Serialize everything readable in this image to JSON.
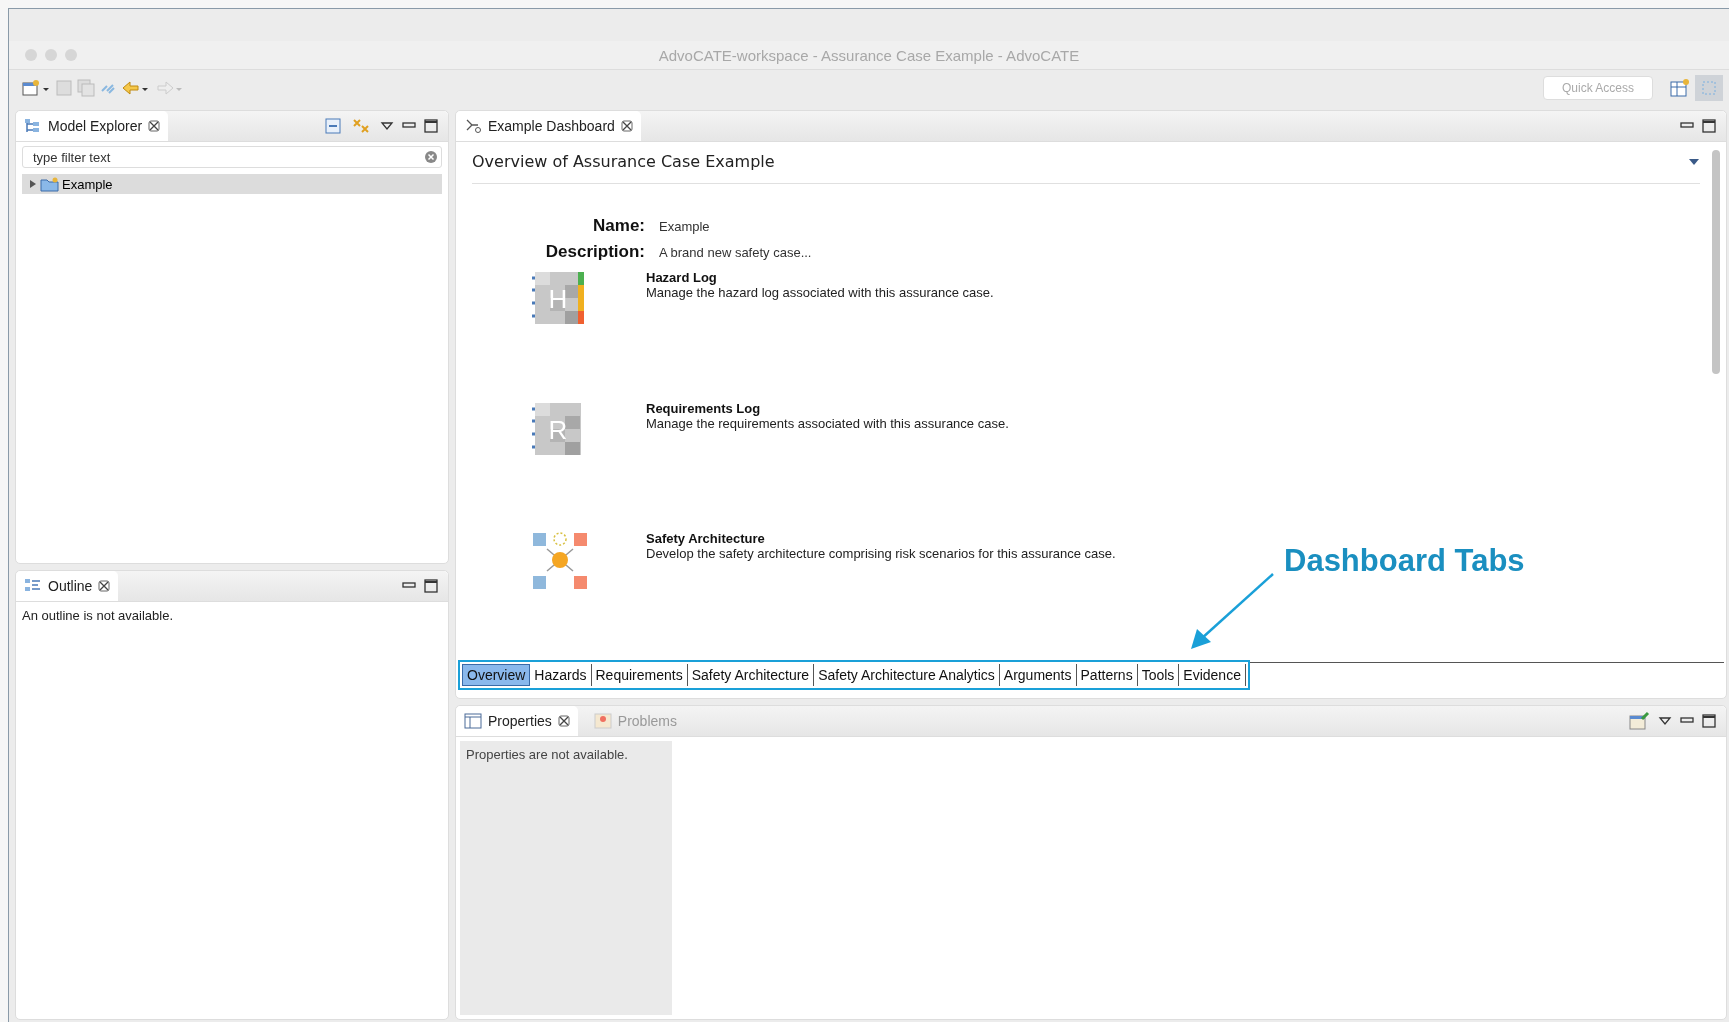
{
  "window": {
    "title": "AdvoCATE-workspace - Assurance Case Example - AdvoCATE"
  },
  "toolbar": {
    "quick_access": {
      "placeholder": "Quick Access"
    }
  },
  "model_explorer": {
    "title": "Model Explorer",
    "filter": {
      "placeholder": "type filter text"
    },
    "tree": [
      {
        "label": "Example",
        "expanded": false,
        "selected": true
      }
    ]
  },
  "outline": {
    "title": "Outline",
    "message": "An outline is not available."
  },
  "editor": {
    "tab": "Example Dashboard",
    "heading": "Overview of Assurance Case Example",
    "fields": [
      {
        "label": "Name:",
        "value": "Example"
      },
      {
        "label": "Description:",
        "value": "A brand new safety case..."
      }
    ],
    "sections": [
      {
        "kind": "hazard",
        "icon_letter": "H",
        "title": "Hazard Log",
        "description": "Manage the hazard log associated with this assurance case."
      },
      {
        "kind": "requirements",
        "icon_letter": "R",
        "title": "Requirements Log",
        "description": "Manage the requirements associated with this assurance case."
      },
      {
        "kind": "architecture",
        "title": "Safety Architecture",
        "description": "Develop the safety architecture comprising risk scenarios for this assurance case."
      }
    ],
    "tabs": [
      {
        "label": "Overview",
        "selected": true
      },
      {
        "label": "Hazards",
        "selected": false
      },
      {
        "label": "Requirements",
        "selected": false
      },
      {
        "label": "Safety Architecture",
        "selected": false
      },
      {
        "label": "Safety Architecture Analytics",
        "selected": false
      },
      {
        "label": "Arguments",
        "selected": false
      },
      {
        "label": "Patterns",
        "selected": false
      },
      {
        "label": "Tools",
        "selected": false
      },
      {
        "label": "Evidence",
        "selected": false
      }
    ]
  },
  "properties": {
    "tabs": [
      {
        "label": "Properties",
        "selected": true
      },
      {
        "label": "Problems",
        "selected": false
      }
    ],
    "message": "Properties are not available."
  },
  "annotation": {
    "text": "Dashboard Tabs"
  }
}
